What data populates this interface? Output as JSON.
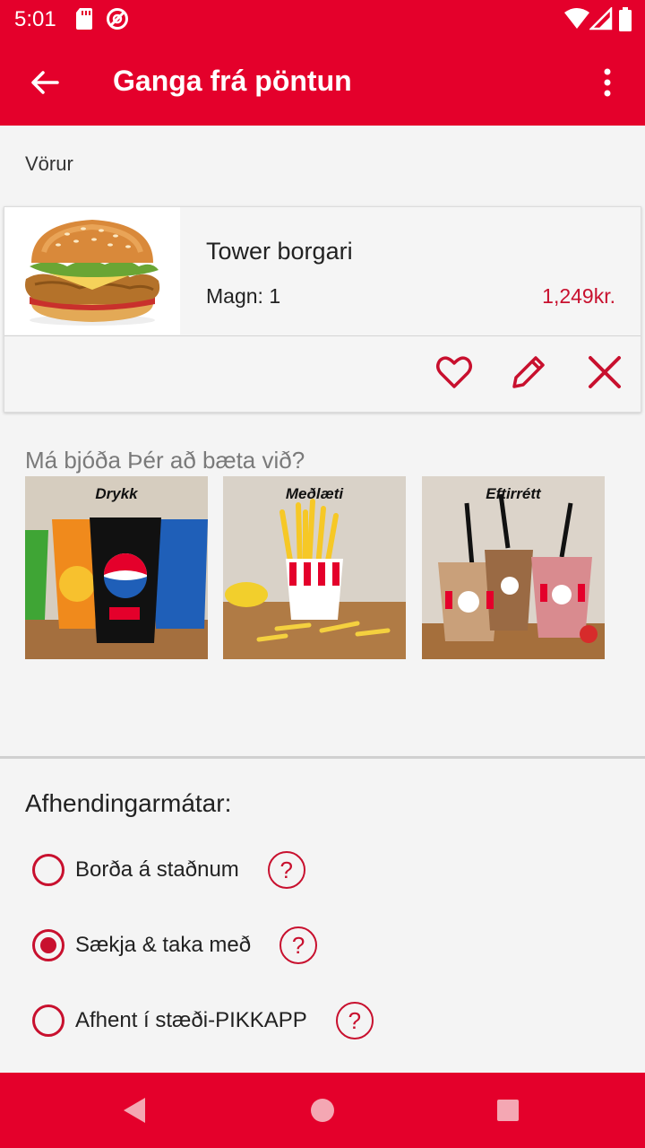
{
  "status_bar": {
    "time": "5:01",
    "icons": [
      "sd-card-icon",
      "no-disturb-icon",
      "wifi-icon",
      "signal-icon",
      "battery-icon"
    ]
  },
  "app_bar": {
    "title": "Ganga frá pöntun",
    "back_icon": "arrow-back-icon",
    "menu_icon": "more-vert-icon"
  },
  "products_section": {
    "label": "Vörur",
    "items": [
      {
        "name": "Tower borgari",
        "quantity": "Magn: 1",
        "price": "1,249kr.",
        "actions": [
          "heart-icon",
          "pencil-icon",
          "close-icon"
        ]
      }
    ]
  },
  "upsell": {
    "title": "Má bjóða Þér að bæta við?",
    "tiles": [
      {
        "label": "Drykk"
      },
      {
        "label": "Meðlæti"
      },
      {
        "label": "Eftirrétt"
      }
    ]
  },
  "delivery": {
    "title": "Afhendingarmátar:",
    "options": [
      {
        "label": "Borða á staðnum",
        "selected": false
      },
      {
        "label": "Sækja & taka með",
        "selected": true
      },
      {
        "label": "Afhent í stæði-PIKKAPP",
        "selected": false
      }
    ],
    "help_symbol": "?"
  },
  "colors": {
    "brand_red": "#e4002b",
    "accent_red": "#c8102e",
    "background": "#f4f4f4"
  }
}
